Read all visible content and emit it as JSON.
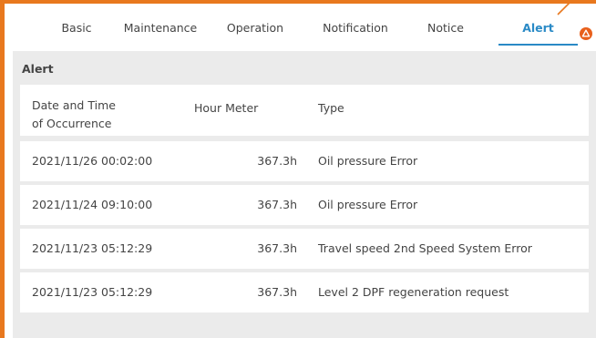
{
  "tabs": [
    {
      "label": "Basic",
      "active": false
    },
    {
      "label": "Maintenance",
      "active": false
    },
    {
      "label": "Operation",
      "active": false
    },
    {
      "label": "Notification",
      "active": false
    },
    {
      "label": "Notice",
      "active": false
    },
    {
      "label": "Alert",
      "active": true
    }
  ],
  "tab_badge_icon": "warning-triangle-icon",
  "panel": {
    "title": "Alert",
    "columns": {
      "date_line1": "Date and Time",
      "date_line2": "of Occurrence",
      "hour_meter": "Hour Meter",
      "type": "Type"
    },
    "rows": [
      {
        "datetime": "2021/11/26 00:02:00",
        "hour_meter": "367.3h",
        "type": "Oil pressure Error"
      },
      {
        "datetime": "2021/11/24 09:10:00",
        "hour_meter": "367.3h",
        "type": "Oil pressure Error"
      },
      {
        "datetime": "2021/11/23 05:12:29",
        "hour_meter": "367.3h",
        "type": "Travel speed 2nd Speed System Error"
      },
      {
        "datetime": "2021/11/23 05:12:29",
        "hour_meter": "367.3h",
        "type": "Level 2 DPF regeneration request"
      }
    ]
  },
  "colors": {
    "frame_border": "#e8781e",
    "accent": "#2a8ac6",
    "warning": "#e8601c",
    "panel_bg": "#ebebeb",
    "text": "#444444"
  }
}
